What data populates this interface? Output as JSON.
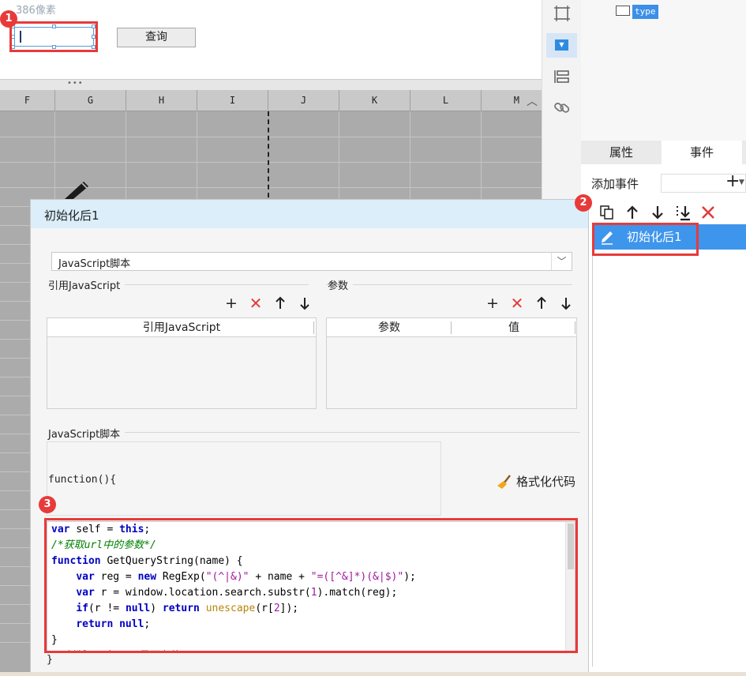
{
  "form": {
    "width_label": "386像素",
    "query_button": "查询"
  },
  "sheet": {
    "columns": [
      "F",
      "G",
      "H",
      "I",
      "J",
      "K",
      "L",
      "M"
    ]
  },
  "tree": {
    "selected_item": "type"
  },
  "right_panel": {
    "tabs": [
      "属性",
      "事件"
    ],
    "add_event_label": "添加事件",
    "add_event_plus": "+",
    "events": [
      {
        "label": "初始化后1",
        "selected": true
      }
    ]
  },
  "dialog": {
    "title": "初始化后1",
    "script_type": "JavaScript脚本",
    "ref_js_section": "引用JavaScript",
    "params_section": "参数",
    "ref_js_grid_header": "引用JavaScript",
    "params_grid_headers": [
      "参数",
      "值"
    ],
    "script_section": "JavaScript脚本",
    "function_header": "function(){",
    "format_code_label": "格式化代码",
    "function_footer": "}",
    "code_lines": [
      "var self = this;",
      "/*获取url中的参数*/",
      "function GetQueryString(name) {",
      "    var reg = new RegExp(\"(^|&)\" + name + \"=([^&]*)(&|$)\");",
      "    var r = window.location.search.substr(1).match(reg);",
      "    if(r != null) return unescape(r[2]);",
      "    return null;",
      "}",
      "/*判断url中name是否有值*/"
    ]
  },
  "callouts": [
    "1",
    "2",
    "3"
  ],
  "colors": {
    "callout_red": "#e83a3a",
    "selection_blue": "#3e95ec",
    "dialog_title_bg": "#dbeefa",
    "keyword_blue": "#0000c0",
    "comment_green": "#008000",
    "string_purple": "#a0199c"
  },
  "icons": {
    "strip": [
      "frame-icon",
      "dropdown-widget-icon",
      "layout-icon",
      "link-icon"
    ],
    "event_toolbar": [
      "copy-icon",
      "arrow-up-icon",
      "arrow-down-icon",
      "move-bottom-icon",
      "delete-icon"
    ]
  }
}
